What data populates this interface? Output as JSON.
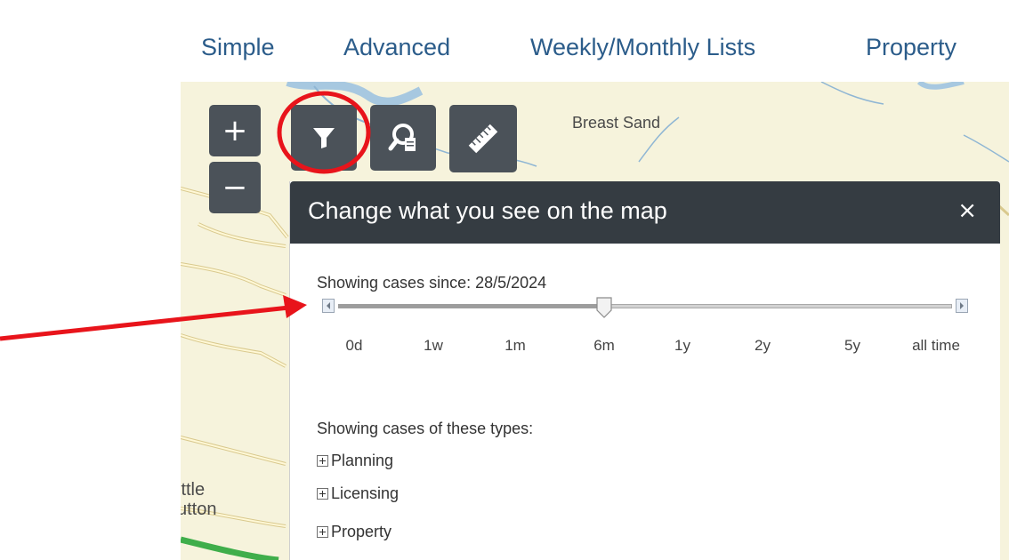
{
  "nav": {
    "items": [
      {
        "label": "Simple"
      },
      {
        "label": "Advanced"
      },
      {
        "label": "Weekly/Monthly Lists"
      },
      {
        "label": "Property"
      }
    ]
  },
  "map": {
    "labels": {
      "breast_sand": "Breast Sand",
      "little_left": "ittle",
      "sutton_left": "utton"
    },
    "zoom_in": "+",
    "zoom_out": "−"
  },
  "toolbar": {
    "filter_icon": "filter-icon",
    "search_icon": "search-document-icon",
    "measure_icon": "ruler-icon"
  },
  "panel": {
    "title": "Change what you see on the map",
    "close": "×",
    "since_label": "Showing cases since: 28/5/2024",
    "slider": {
      "ticks": [
        "0d",
        "1w",
        "1m",
        "6m",
        "1y",
        "2y",
        "5y",
        "all time"
      ],
      "selected_index": 3
    },
    "types_label": "Showing cases of these types:",
    "types": [
      {
        "label": "Planning"
      },
      {
        "label": "Licensing"
      },
      {
        "label": "Property"
      }
    ]
  },
  "annotations": {
    "highlight_color": "#e8141b"
  }
}
